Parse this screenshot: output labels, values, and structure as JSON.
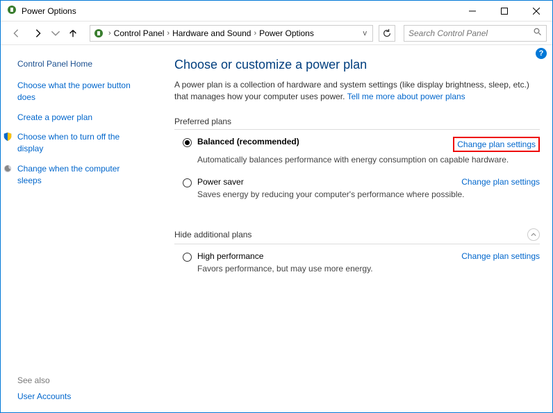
{
  "window": {
    "title": "Power Options"
  },
  "breadcrumb": {
    "items": [
      "Control Panel",
      "Hardware and Sound",
      "Power Options"
    ]
  },
  "search": {
    "placeholder": "Search Control Panel"
  },
  "sidebar": {
    "home": "Control Panel Home",
    "links": [
      {
        "label": "Choose what the power button does"
      },
      {
        "label": "Create a power plan"
      },
      {
        "label": "Choose when to turn off the display",
        "icon": "shield"
      },
      {
        "label": "Change when the computer sleeps",
        "icon": "moon"
      }
    ],
    "see_also_header": "See also",
    "see_also_link": "User Accounts"
  },
  "main": {
    "heading": "Choose or customize a power plan",
    "intro_text": "A power plan is a collection of hardware and system settings (like display brightness, sleep, etc.) that manages how your computer uses power. ",
    "intro_link": "Tell me more about power plans",
    "preferred_header": "Preferred plans",
    "hidden_header": "Hide additional plans",
    "change_link": "Change plan settings",
    "plans_preferred": [
      {
        "title": "Balanced (recommended)",
        "desc": "Automatically balances performance with energy consumption on capable hardware.",
        "selected": true,
        "highlight": true
      },
      {
        "title": "Power saver",
        "desc": "Saves energy by reducing your computer's performance where possible.",
        "selected": false,
        "highlight": false
      }
    ],
    "plans_hidden": [
      {
        "title": "High performance",
        "desc": "Favors performance, but may use more energy.",
        "selected": false,
        "highlight": false
      }
    ]
  }
}
